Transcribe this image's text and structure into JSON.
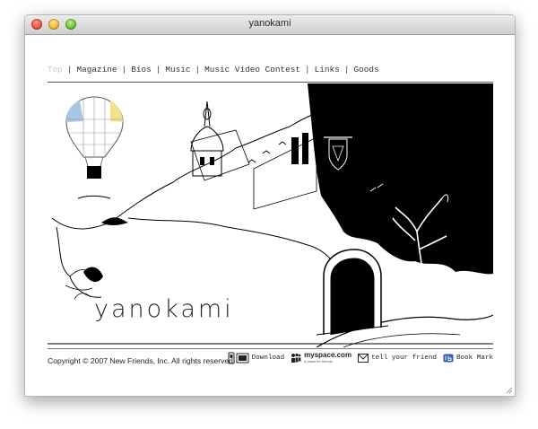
{
  "window": {
    "title": "yanokami"
  },
  "nav": {
    "items": [
      {
        "label": "Top",
        "active": true
      },
      {
        "label": "Magazine"
      },
      {
        "label": "Bios"
      },
      {
        "label": "Music"
      },
      {
        "label": "Music Video Contest"
      },
      {
        "label": "Links"
      },
      {
        "label": "Goods"
      }
    ]
  },
  "hero": {
    "logo_text": "yanokami"
  },
  "footer": {
    "copyright": "Copyright © 2007 New Friends, Inc. All rights reserved.",
    "download_label": "Download",
    "myspace_label": "myspace.com",
    "myspace_tagline": "a place for friends",
    "tell_friend_label": "tell your friend",
    "bookmark_label": "Book Mark"
  },
  "colors": {
    "active_nav": "#c8c8c8",
    "text": "#333333",
    "balloon_blue": "#a9c6e6",
    "balloon_yellow": "#efe28a"
  },
  "icons": [
    "phone-icon",
    "download-icon",
    "myspace-icon",
    "envelope-icon",
    "bookmark-icon"
  ]
}
